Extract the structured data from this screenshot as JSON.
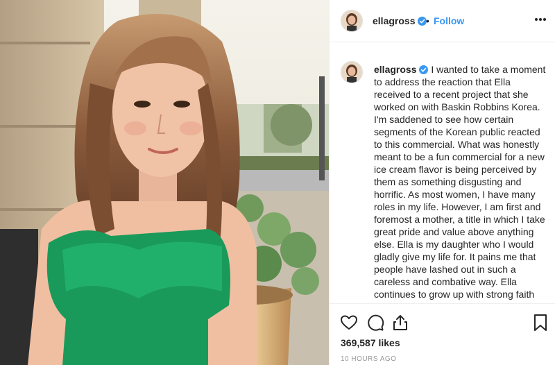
{
  "post": {
    "username": "ellagross",
    "separator": "•",
    "follow_label": "Follow",
    "caption": "I wanted to take a moment to address the reaction that Ella received to a recent project that she worked on with Baskin Robbins Korea. I'm saddened to see how certain segments of the Korean public reacted to this commercial. What was honestly meant to be a fun commercial for a new ice cream flavor is being perceived by them as something disgusting and horrific. As most women, I have many roles in my life. However, I am first and foremost a mother, a title in which I take great pride and value above anything else. Ella is my daughter who I would gladly give my life for. It pains me that people have lashed out in such a careless and combative way. Ella continues to grow up with strong faith",
    "likes": "369,587 likes",
    "timestamp": "10 HOURS AGO"
  },
  "icons": {
    "verified": "verified-badge-icon",
    "more": "more-options-icon",
    "like": "heart-icon",
    "comment": "comment-icon",
    "share": "share-icon",
    "save": "bookmark-icon"
  },
  "colors": {
    "link": "#3897f0",
    "verified": "#3897f0",
    "text": "#262626",
    "muted": "#999999",
    "border": "#efefef"
  }
}
